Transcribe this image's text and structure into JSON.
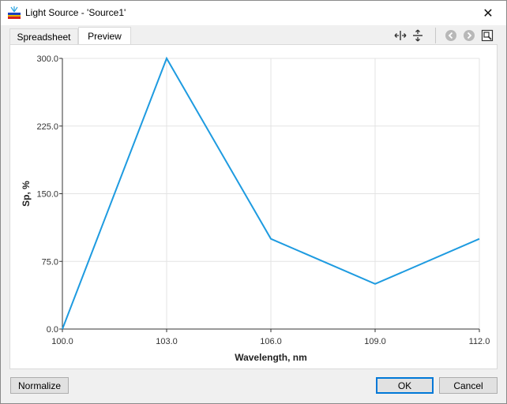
{
  "window": {
    "title": "Light Source - 'Source1'",
    "close_glyph": "✕"
  },
  "tabs": [
    {
      "label": "Spreadsheet",
      "active": false
    },
    {
      "label": "Preview",
      "active": true
    }
  ],
  "toolbar": {
    "icons": [
      "fit-width-icon",
      "fit-height-icon",
      "back-icon",
      "forward-icon",
      "export-icon"
    ]
  },
  "chart_data": {
    "type": "line",
    "xlabel": "Wavelength, nm",
    "ylabel": "Sp, %",
    "x": [
      100.0,
      103.0,
      106.0,
      109.0,
      112.0
    ],
    "series": [
      {
        "values": [
          0.0,
          300.0,
          100.0,
          50.0,
          100.0
        ],
        "color": "#1e9be0"
      }
    ],
    "xlim": [
      100.0,
      112.0
    ],
    "ylim": [
      0.0,
      300.0
    ],
    "xticks": [
      "100.0",
      "103.0",
      "106.0",
      "109.0",
      "112.0"
    ],
    "yticks": [
      "0.0",
      "75.0",
      "150.0",
      "225.0",
      "300.0"
    ],
    "grid": true
  },
  "buttons": {
    "normalize": "Normalize",
    "ok": "OK",
    "cancel": "Cancel"
  }
}
